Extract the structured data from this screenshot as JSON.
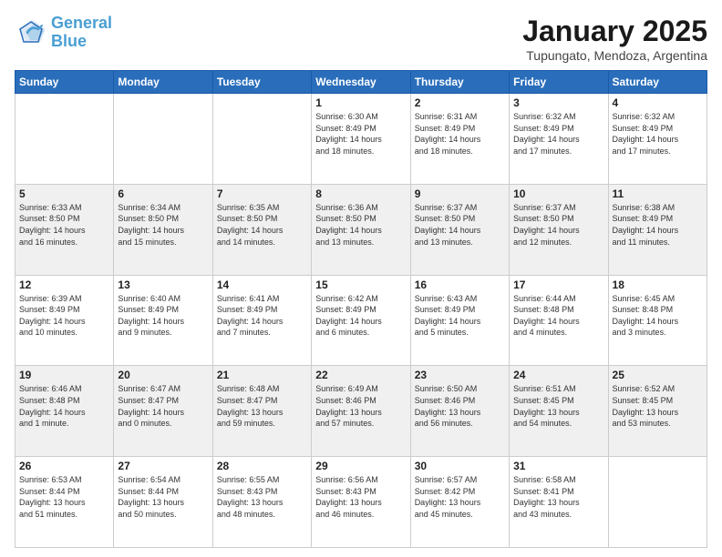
{
  "header": {
    "logo_line1": "General",
    "logo_line2": "Blue",
    "title": "January 2025",
    "subtitle": "Tupungato, Mendoza, Argentina"
  },
  "weekdays": [
    "Sunday",
    "Monday",
    "Tuesday",
    "Wednesday",
    "Thursday",
    "Friday",
    "Saturday"
  ],
  "weeks": [
    [
      {
        "day": "",
        "info": ""
      },
      {
        "day": "",
        "info": ""
      },
      {
        "day": "",
        "info": ""
      },
      {
        "day": "1",
        "info": "Sunrise: 6:30 AM\nSunset: 8:49 PM\nDaylight: 14 hours\nand 18 minutes."
      },
      {
        "day": "2",
        "info": "Sunrise: 6:31 AM\nSunset: 8:49 PM\nDaylight: 14 hours\nand 18 minutes."
      },
      {
        "day": "3",
        "info": "Sunrise: 6:32 AM\nSunset: 8:49 PM\nDaylight: 14 hours\nand 17 minutes."
      },
      {
        "day": "4",
        "info": "Sunrise: 6:32 AM\nSunset: 8:49 PM\nDaylight: 14 hours\nand 17 minutes."
      }
    ],
    [
      {
        "day": "5",
        "info": "Sunrise: 6:33 AM\nSunset: 8:50 PM\nDaylight: 14 hours\nand 16 minutes."
      },
      {
        "day": "6",
        "info": "Sunrise: 6:34 AM\nSunset: 8:50 PM\nDaylight: 14 hours\nand 15 minutes."
      },
      {
        "day": "7",
        "info": "Sunrise: 6:35 AM\nSunset: 8:50 PM\nDaylight: 14 hours\nand 14 minutes."
      },
      {
        "day": "8",
        "info": "Sunrise: 6:36 AM\nSunset: 8:50 PM\nDaylight: 14 hours\nand 13 minutes."
      },
      {
        "day": "9",
        "info": "Sunrise: 6:37 AM\nSunset: 8:50 PM\nDaylight: 14 hours\nand 13 minutes."
      },
      {
        "day": "10",
        "info": "Sunrise: 6:37 AM\nSunset: 8:50 PM\nDaylight: 14 hours\nand 12 minutes."
      },
      {
        "day": "11",
        "info": "Sunrise: 6:38 AM\nSunset: 8:49 PM\nDaylight: 14 hours\nand 11 minutes."
      }
    ],
    [
      {
        "day": "12",
        "info": "Sunrise: 6:39 AM\nSunset: 8:49 PM\nDaylight: 14 hours\nand 10 minutes."
      },
      {
        "day": "13",
        "info": "Sunrise: 6:40 AM\nSunset: 8:49 PM\nDaylight: 14 hours\nand 9 minutes."
      },
      {
        "day": "14",
        "info": "Sunrise: 6:41 AM\nSunset: 8:49 PM\nDaylight: 14 hours\nand 7 minutes."
      },
      {
        "day": "15",
        "info": "Sunrise: 6:42 AM\nSunset: 8:49 PM\nDaylight: 14 hours\nand 6 minutes."
      },
      {
        "day": "16",
        "info": "Sunrise: 6:43 AM\nSunset: 8:49 PM\nDaylight: 14 hours\nand 5 minutes."
      },
      {
        "day": "17",
        "info": "Sunrise: 6:44 AM\nSunset: 8:48 PM\nDaylight: 14 hours\nand 4 minutes."
      },
      {
        "day": "18",
        "info": "Sunrise: 6:45 AM\nSunset: 8:48 PM\nDaylight: 14 hours\nand 3 minutes."
      }
    ],
    [
      {
        "day": "19",
        "info": "Sunrise: 6:46 AM\nSunset: 8:48 PM\nDaylight: 14 hours\nand 1 minute."
      },
      {
        "day": "20",
        "info": "Sunrise: 6:47 AM\nSunset: 8:47 PM\nDaylight: 14 hours\nand 0 minutes."
      },
      {
        "day": "21",
        "info": "Sunrise: 6:48 AM\nSunset: 8:47 PM\nDaylight: 13 hours\nand 59 minutes."
      },
      {
        "day": "22",
        "info": "Sunrise: 6:49 AM\nSunset: 8:46 PM\nDaylight: 13 hours\nand 57 minutes."
      },
      {
        "day": "23",
        "info": "Sunrise: 6:50 AM\nSunset: 8:46 PM\nDaylight: 13 hours\nand 56 minutes."
      },
      {
        "day": "24",
        "info": "Sunrise: 6:51 AM\nSunset: 8:45 PM\nDaylight: 13 hours\nand 54 minutes."
      },
      {
        "day": "25",
        "info": "Sunrise: 6:52 AM\nSunset: 8:45 PM\nDaylight: 13 hours\nand 53 minutes."
      }
    ],
    [
      {
        "day": "26",
        "info": "Sunrise: 6:53 AM\nSunset: 8:44 PM\nDaylight: 13 hours\nand 51 minutes."
      },
      {
        "day": "27",
        "info": "Sunrise: 6:54 AM\nSunset: 8:44 PM\nDaylight: 13 hours\nand 50 minutes."
      },
      {
        "day": "28",
        "info": "Sunrise: 6:55 AM\nSunset: 8:43 PM\nDaylight: 13 hours\nand 48 minutes."
      },
      {
        "day": "29",
        "info": "Sunrise: 6:56 AM\nSunset: 8:43 PM\nDaylight: 13 hours\nand 46 minutes."
      },
      {
        "day": "30",
        "info": "Sunrise: 6:57 AM\nSunset: 8:42 PM\nDaylight: 13 hours\nand 45 minutes."
      },
      {
        "day": "31",
        "info": "Sunrise: 6:58 AM\nSunset: 8:41 PM\nDaylight: 13 hours\nand 43 minutes."
      },
      {
        "day": "",
        "info": ""
      }
    ]
  ]
}
